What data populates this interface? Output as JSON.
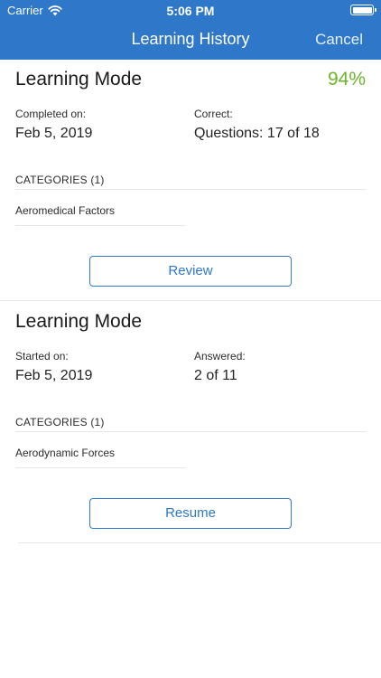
{
  "status_bar": {
    "carrier": "Carrier",
    "time": "5:06 PM",
    "icons": [
      "wifi-icon",
      "battery-icon"
    ]
  },
  "nav": {
    "title": "Learning History",
    "cancel": "Cancel",
    "color": "#2e77c9"
  },
  "sessions": [
    {
      "mode": "Learning Mode",
      "score": "94%",
      "score_color": "#6ab42a",
      "left_label": "Completed on:",
      "left_value": "Feb 5, 2019",
      "right_label": "Correct:",
      "right_value": "Questions: 17 of 18",
      "categories_header": "CATEGORIES (1)",
      "categories": [
        "Aeromedical Factors"
      ],
      "button": "Review"
    },
    {
      "mode": "Learning Mode",
      "left_label": "Started on:",
      "left_value": "Feb 5, 2019",
      "right_label": "Answered:",
      "right_value": "2 of 11",
      "categories_header": "CATEGORIES (1)",
      "categories": [
        "Aerodynamic Forces"
      ],
      "button": "Resume"
    }
  ]
}
